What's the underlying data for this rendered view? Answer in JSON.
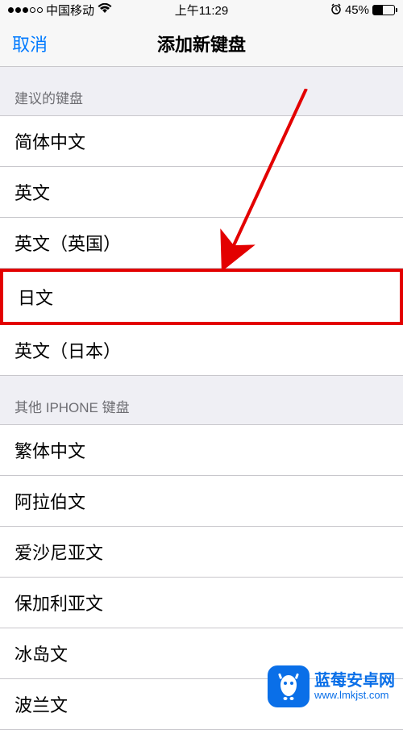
{
  "statusBar": {
    "carrier": "中国移动",
    "time": "上午11:29",
    "batteryPercent": "45%"
  },
  "navBar": {
    "cancel": "取消",
    "title": "添加新键盘"
  },
  "sections": {
    "suggested": {
      "header": "建议的键盘",
      "items": {
        "0": "简体中文",
        "1": "英文",
        "2": "英文（英国）",
        "3": "日文",
        "4": "英文（日本）"
      }
    },
    "other": {
      "header": "其他 IPHONE 键盘",
      "items": {
        "0": "繁体中文",
        "1": "阿拉伯文",
        "2": "爱沙尼亚文",
        "3": "保加利亚文",
        "4": "冰岛文",
        "5": "波兰文"
      }
    }
  },
  "watermark": {
    "title": "蓝莓安卓网",
    "url": "www.lmkjst.com"
  }
}
